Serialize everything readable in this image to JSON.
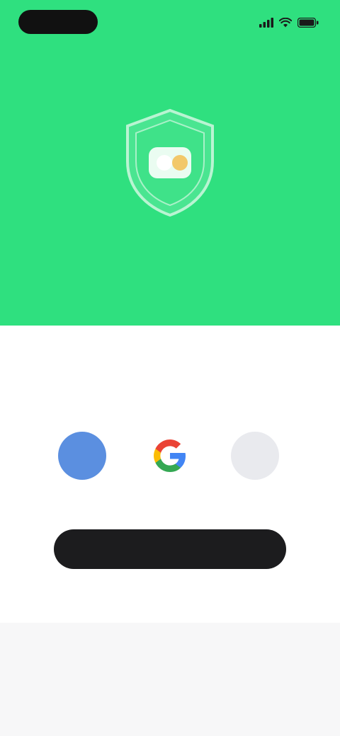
{
  "status_bar": {
    "time": "",
    "icons": [
      "signal-icon",
      "wifi-icon",
      "battery-icon"
    ]
  },
  "hero": {
    "background_color": "#2fe07f",
    "emblem": "shield-icon"
  },
  "sheet": {
    "title": "",
    "providers": [
      {
        "name": "",
        "icon": "blue-circle-icon",
        "color": "#5b8fe0"
      },
      {
        "name": "",
        "icon": "google-icon",
        "color": "#ffffff"
      },
      {
        "name": "",
        "icon": "gray-circle-icon",
        "color": "#e9eaee"
      }
    ],
    "primary_button_label": ""
  },
  "footer": {
    "text": "",
    "link_text": ""
  }
}
